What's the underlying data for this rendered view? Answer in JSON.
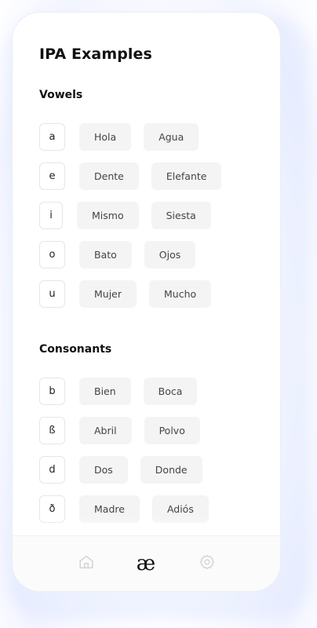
{
  "title": "IPA Examples",
  "sections": [
    {
      "name": "Vowels",
      "rows": [
        {
          "symbol": "a",
          "examples": [
            "Hola",
            "Agua"
          ]
        },
        {
          "symbol": "e",
          "examples": [
            "Dente",
            "Elefante"
          ]
        },
        {
          "symbol": "i",
          "examples": [
            "Mismo",
            "Siesta"
          ]
        },
        {
          "symbol": "o",
          "examples": [
            "Bato",
            "Ojos"
          ]
        },
        {
          "symbol": "u",
          "examples": [
            "Mujer",
            "Mucho"
          ]
        }
      ]
    },
    {
      "name": "Consonants",
      "rows": [
        {
          "symbol": "b",
          "examples": [
            "Bien",
            "Boca"
          ]
        },
        {
          "symbol": "ß",
          "examples": [
            "Abril",
            "Polvo"
          ]
        },
        {
          "symbol": "d",
          "examples": [
            "Dos",
            "Donde"
          ]
        },
        {
          "symbol": "ð",
          "examples": [
            "Madre",
            "Adiós"
          ]
        }
      ]
    }
  ],
  "tabbar": {
    "home_icon": "home-icon",
    "ipa_tab_label": "æ",
    "settings_icon": "settings-icon",
    "active_color": "#111111",
    "inactive_color": "#d3d3d3"
  }
}
